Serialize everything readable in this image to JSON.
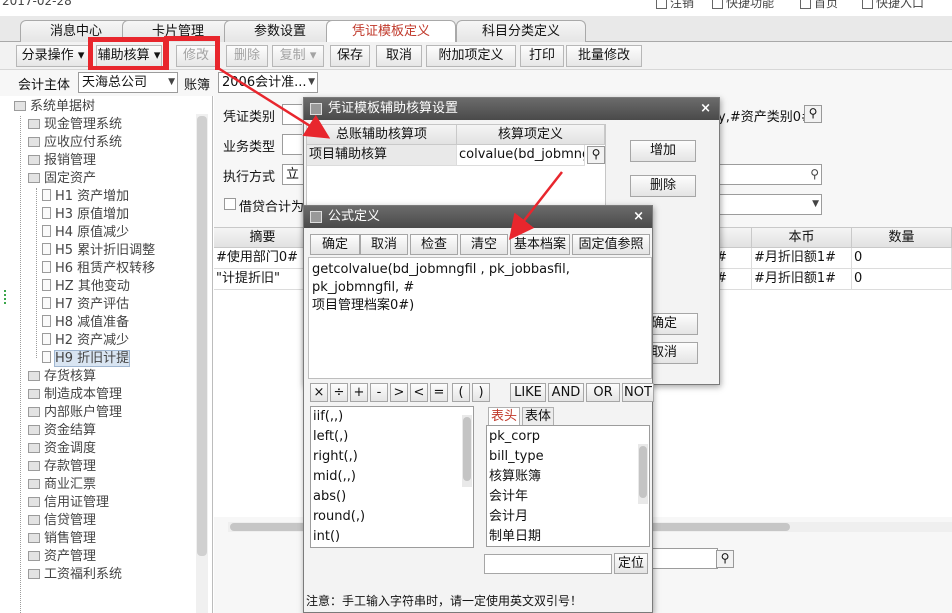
{
  "top_strip": {
    "date": "2017-02-28",
    "items": [
      "注销",
      "快捷功能",
      "首页",
      "快捷入口"
    ]
  },
  "tabs": [
    "消息中心",
    "卡片管理",
    "参数设置",
    "凭证模板定义",
    "科目分类定义"
  ],
  "active_tab": 3,
  "toolbar": {
    "split_op": "分录操作",
    "aux_calc": "辅助核算",
    "modify": "修改",
    "delete": "删除",
    "copy": "复制",
    "save": "保存",
    "cancel": "取消",
    "extra_def": "附加项定义",
    "print": "打印",
    "batch_modify": "批量修改"
  },
  "filter": {
    "entity_label": "会计主体",
    "entity_value": "天海总公司",
    "book_label": "账簿",
    "book_value": "2006会计准..."
  },
  "tree": {
    "root": "系统单据树",
    "items": [
      {
        "label": "现金管理系统",
        "type": "folder"
      },
      {
        "label": "应收应付系统",
        "type": "folder"
      },
      {
        "label": "报销管理",
        "type": "folder"
      },
      {
        "label": "固定资产",
        "type": "folder"
      },
      {
        "label": "H1 资产增加",
        "type": "doc"
      },
      {
        "label": "H3 原值增加",
        "type": "doc"
      },
      {
        "label": "H4 原值减少",
        "type": "doc"
      },
      {
        "label": "H5 累计折旧调整",
        "type": "doc"
      },
      {
        "label": "H6 租赁产权转移",
        "type": "doc"
      },
      {
        "label": "HZ 其他变动",
        "type": "doc"
      },
      {
        "label": "H7 资产评估",
        "type": "doc"
      },
      {
        "label": "H8 减值准备",
        "type": "doc"
      },
      {
        "label": "H2 资产减少",
        "type": "doc"
      },
      {
        "label": "H9 折旧计提",
        "type": "doc",
        "selected": true
      },
      {
        "label": "存货核算",
        "type": "folder"
      },
      {
        "label": "制造成本管理",
        "type": "folder"
      },
      {
        "label": "内部账户管理",
        "type": "folder"
      },
      {
        "label": "资金结算",
        "type": "folder"
      },
      {
        "label": "资金调度",
        "type": "folder"
      },
      {
        "label": "存款管理",
        "type": "folder"
      },
      {
        "label": "商业汇票",
        "type": "folder"
      },
      {
        "label": "信用证管理",
        "type": "folder"
      },
      {
        "label": "信贷管理",
        "type": "folder"
      },
      {
        "label": "销售管理",
        "type": "folder"
      },
      {
        "label": "资产管理",
        "type": "folder"
      },
      {
        "label": "工资福利系统",
        "type": "folder"
      }
    ]
  },
  "main": {
    "voucher_type_label": "凭证类别",
    "business_type_label": "业务类型",
    "exec_mode_label": "执行方式",
    "exec_mode_value": "立",
    "debit_credit_label": "借贷合计为",
    "formula_snippet": "y,#资产类别0#)",
    "grid_headers": [
      "摘要",
      "本币",
      "数量"
    ],
    "grid_rows": [
      {
        "summary": "#使用部门0#",
        "mid": ",#",
        "local": "#月折旧额1#",
        "qty": "0"
      },
      {
        "summary": "\"计提折旧\"",
        "mid": ",#",
        "local": "#月折旧额1#",
        "qty": "0"
      }
    ]
  },
  "aux_dialog": {
    "title": "凭证模板辅助核算设置",
    "col_item": "总账辅助核算项",
    "col_def": "核算项定义",
    "row_item": "项目辅助核算",
    "row_def": "colvalue(bd_jobmngfil",
    "add": "增加",
    "delete": "删除",
    "ok": "确定",
    "cancel": "取消"
  },
  "formula_dialog": {
    "title": "公式定义",
    "buttons": [
      "确定",
      "取消",
      "检查",
      "清空",
      "基本档案",
      "固定值参照"
    ],
    "formula_line1": "getcolvalue(bd_jobmngfil , pk_jobbasfil, pk_jobmngfil, #",
    "formula_line2": "项目管理档案0#)",
    "operators": [
      "×",
      "÷",
      "+",
      "-",
      ">",
      "<",
      "=",
      "(",
      ")",
      "LIKE",
      "AND",
      "OR",
      "NOT"
    ],
    "functions": [
      "iif(,,)",
      "left(,)",
      "right(,)",
      "mid(,,)",
      "abs()",
      "round(,)",
      "int()"
    ],
    "field_tabs": [
      "表头",
      "表体"
    ],
    "fields": [
      "pk_corp",
      "bill_type",
      "核算账簿",
      "会计年",
      "会计月",
      "制单日期"
    ],
    "locate": "定位",
    "note": "注意：手工输入字符串时，请一定使用英文双引号！"
  },
  "colors": {
    "highlight": "#e8262d",
    "title_bar": "#555555",
    "tab_active_text": "#c0392b"
  }
}
